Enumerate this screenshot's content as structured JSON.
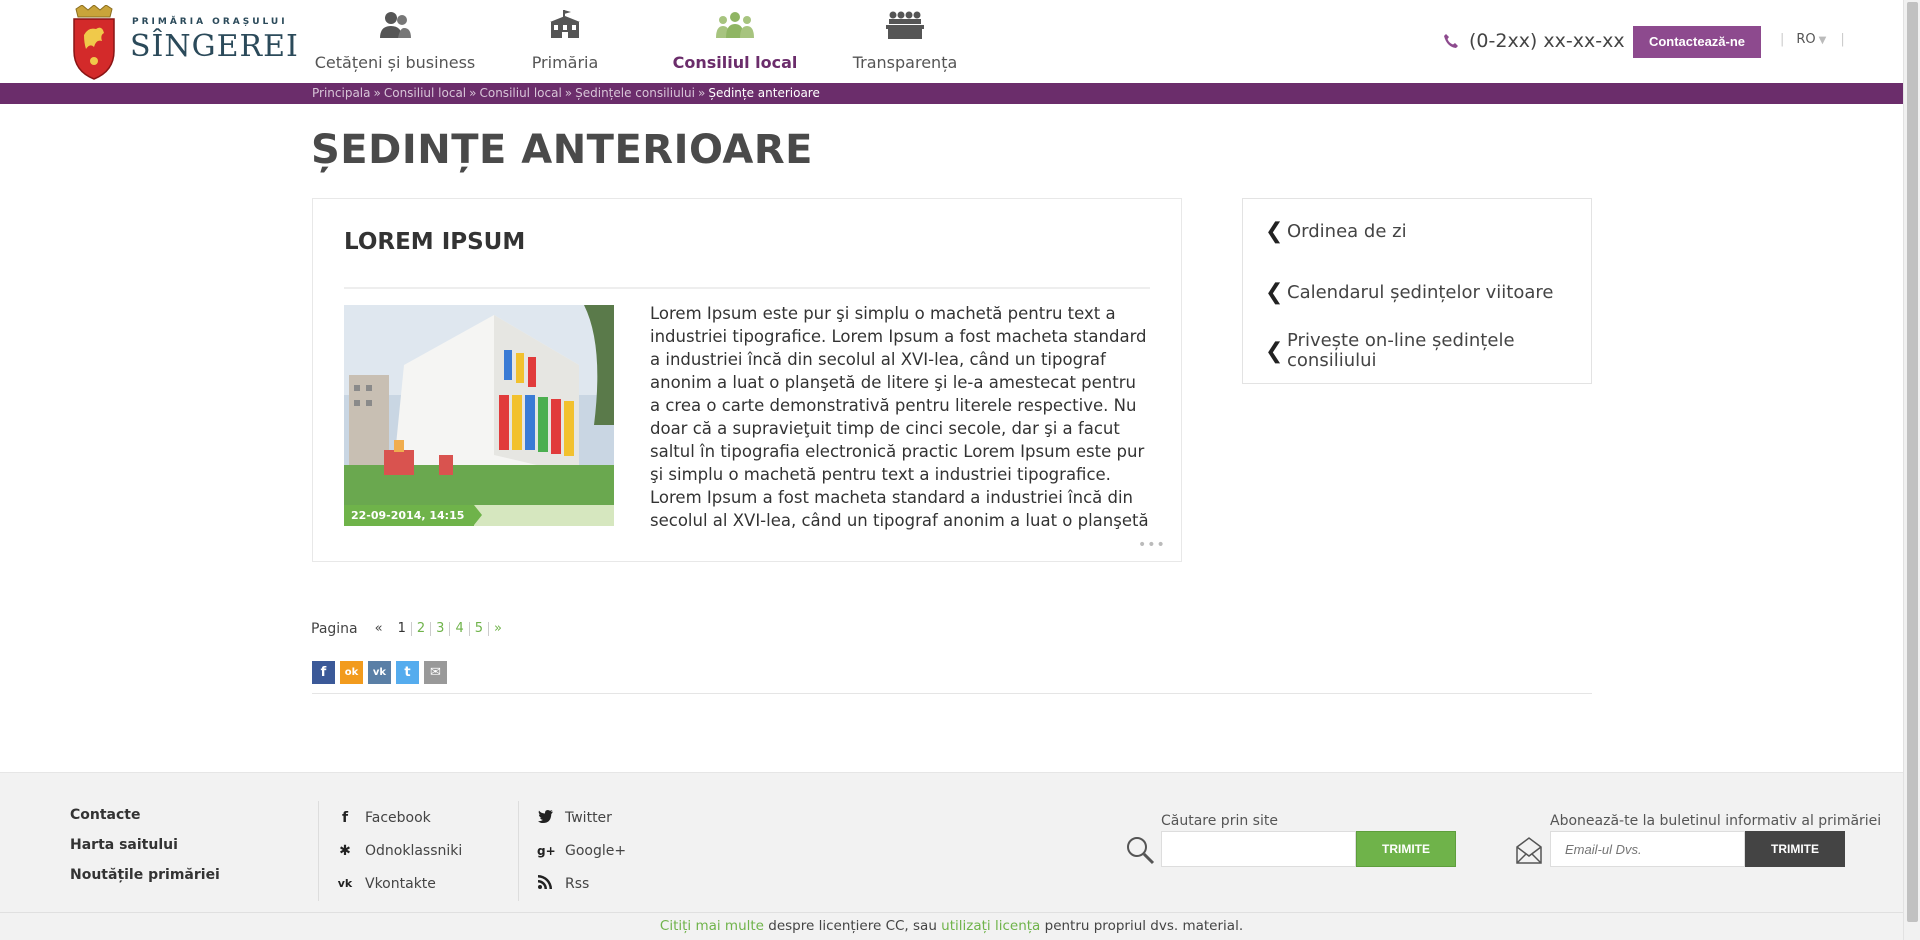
{
  "header": {
    "logo_subtitle": "PRIMĂRIA ORAȘULUI",
    "logo_name": "SÎNGEREI",
    "nav": [
      {
        "label": "Cetățeni și business",
        "icon": "people-icon",
        "active": false
      },
      {
        "label": "Primăria",
        "icon": "building-icon",
        "active": false
      },
      {
        "label": "Consiliul local",
        "icon": "council-icon",
        "active": true
      },
      {
        "label": "Transparența",
        "icon": "meeting-icon",
        "active": false
      }
    ],
    "phone": "(0-2xx) xx-xx-xx",
    "contact_button": "Contactează-ne",
    "language": "RO",
    "accent_color": "#6b2d6b",
    "button_color": "#8d4a8e"
  },
  "breadcrumb": {
    "items": [
      "Principala",
      "Consiliul local",
      "Consiliul local",
      "Ședințele consiliului"
    ],
    "current": "Ședințe anterioare",
    "separator": "»"
  },
  "main": {
    "page_title": "ȘEDINȚE ANTERIOARE",
    "article": {
      "title": "LOREM IPSUM",
      "date": "22-09-2014, 14:15",
      "text": "Lorem Ipsum este pur şi simplu o machetă pentru text a industriei tipografice. Lorem Ipsum a fost macheta standard a industriei încă din secolul al XVI-lea, când un tipograf anonim a luat o planşetă de litere şi le-a amestecat pentru a crea o carte demonstrativă pentru literele respective. Nu doar că a supravieţuit timp de cinci secole, dar şi a facut saltul în tipografia electronică practic  Lorem Ipsum este pur şi simplu o machetă pentru text a industriei tipografice. Lorem Ipsum a fost macheta standard a industriei încă din secolul al XVI-lea, când un tipograf anonim a luat o planşetă",
      "more": "•••"
    },
    "sidebar": [
      {
        "label": "Ordinea de zi"
      },
      {
        "label": "Calendarul ședințelor viitoare"
      },
      {
        "label": "Privește on-line ședințele consiliului"
      }
    ],
    "pager": {
      "label": "Pagina",
      "prev": "«",
      "pages": [
        "1",
        "2",
        "3",
        "4",
        "5"
      ],
      "current": "1",
      "next": "»"
    },
    "share": [
      {
        "icon": "facebook-icon",
        "glyph": "f",
        "color": "#3b5998"
      },
      {
        "icon": "odnoklassniki-icon",
        "glyph": "ok",
        "color": "#f29b1d"
      },
      {
        "icon": "vkontakte-icon",
        "glyph": "vk",
        "color": "#5a7fa6"
      },
      {
        "icon": "twitter-icon",
        "glyph": "t",
        "color": "#55acee"
      },
      {
        "icon": "email-icon",
        "glyph": "✉",
        "color": "#999999"
      }
    ]
  },
  "footer": {
    "links": [
      "Contacte",
      "Harta saitului",
      "Noutățile primăriei"
    ],
    "social_col1": [
      {
        "label": "Facebook",
        "icon": "facebook-icon",
        "glyph": "f"
      },
      {
        "label": "Odnoklassniki",
        "icon": "odnoklassniki-icon",
        "glyph": "✱"
      },
      {
        "label": "Vkontakte",
        "icon": "vkontakte-icon",
        "glyph": "vk"
      }
    ],
    "social_col2": [
      {
        "label": "Twitter",
        "icon": "twitter-icon",
        "glyph": "🐦"
      },
      {
        "label": "Google+",
        "icon": "googleplus-icon",
        "glyph": "g+"
      },
      {
        "label": "Rss",
        "icon": "rss-icon",
        "glyph": "◗"
      }
    ],
    "search_label": "Căutare prin site",
    "search_placeholder": "",
    "search_button": "TRIMITE",
    "newsletter_label": "Abonează-te la buletinul informativ al primăriei",
    "newsletter_placeholder": "Email-ul Dvs.",
    "newsletter_button": "TRIMITE",
    "copyright": {
      "link1": "Citiți mai multe",
      "text1": " despre licențiere CC, sau ",
      "link2": "utilizați licența",
      "text2": " pentru propriul dvs. material."
    }
  }
}
